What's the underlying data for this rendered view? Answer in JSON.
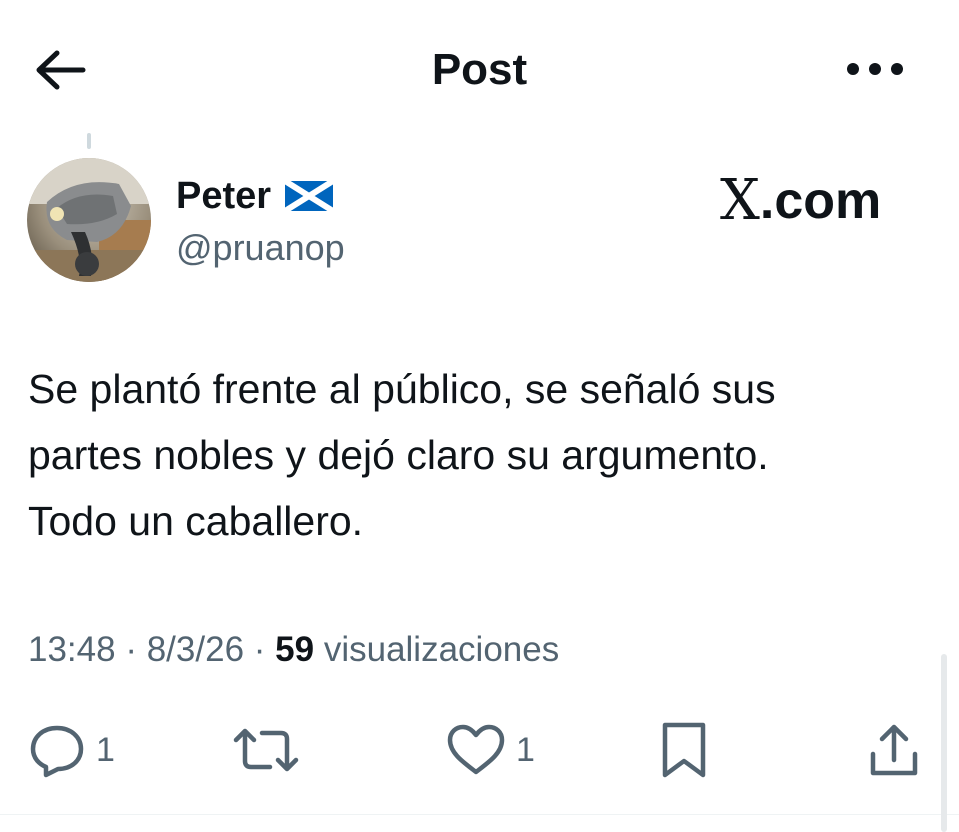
{
  "header": {
    "title": "Post",
    "back_icon": "arrow-left-icon",
    "more_icon": "more-horizontal-icon"
  },
  "author": {
    "name": "Peter",
    "flag": "scotland-flag-icon",
    "handle": "@pruanop"
  },
  "watermark": {
    "x_letter": "X",
    "suffix": ".com"
  },
  "post": {
    "text": "Se plantó frente al público, se señaló sus\npartes nobles y dejó claro su argumento.\nTodo un caballero."
  },
  "meta": {
    "time": "13:48",
    "separator": "·",
    "date": "8/3/26",
    "views_count": "59",
    "views_label": "visualizaciones"
  },
  "actions": {
    "reply_count": "1",
    "like_count": "1"
  },
  "colors": {
    "text_primary": "#0f1419",
    "text_secondary": "#536471",
    "divider": "#eff3f4",
    "flag_blue": "#0065bd"
  }
}
